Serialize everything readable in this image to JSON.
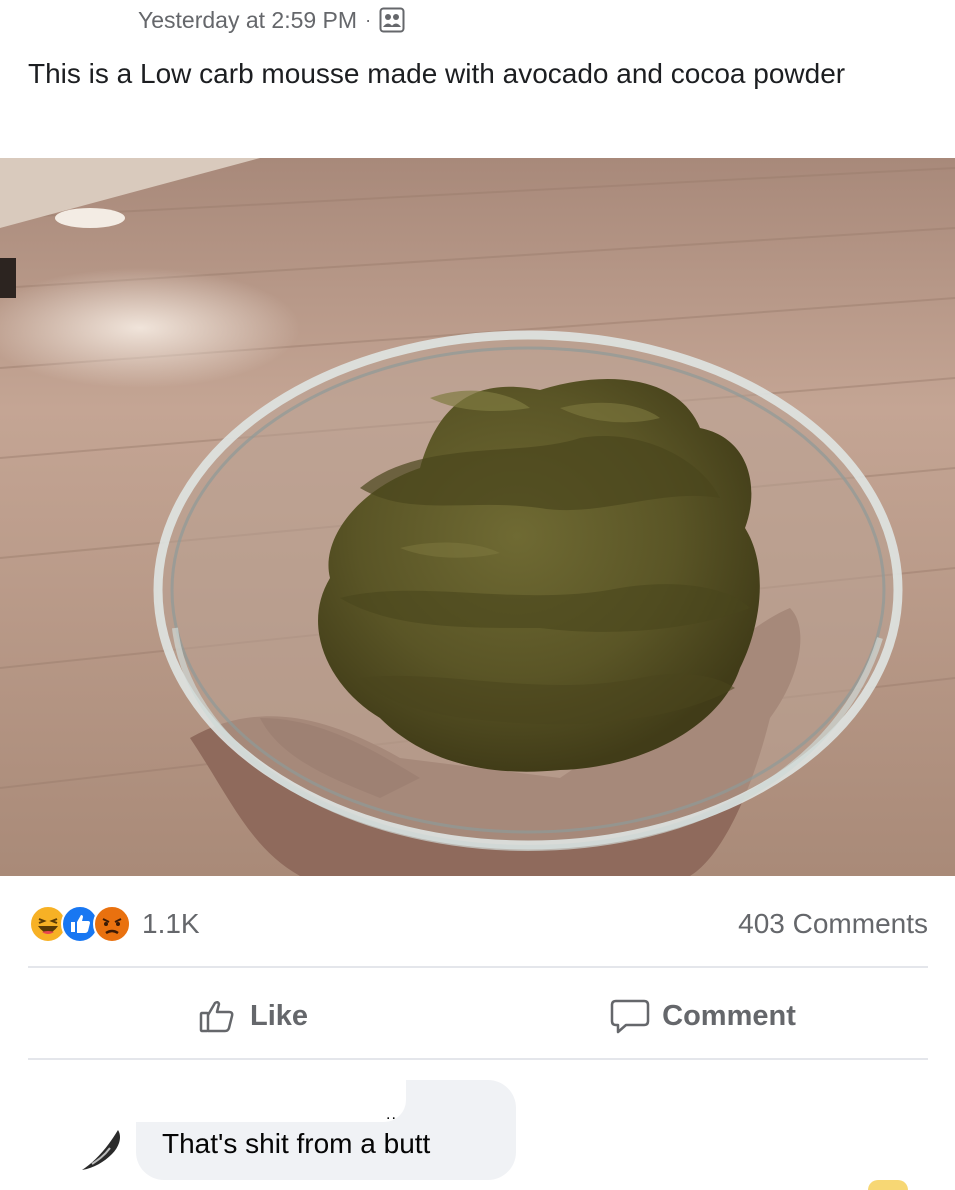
{
  "post": {
    "timestamp": "Yesterday at 2:59 PM",
    "separator": "·",
    "audience_icon": "friends-icon",
    "caption": "This is a Low carb mousse made with avocado and cocoa powder"
  },
  "photo": {
    "subject": "glass-bowl-of-brown-mousse"
  },
  "reactions": {
    "icons": [
      "haha-icon",
      "like-icon",
      "angry-icon"
    ],
    "count": "1.1K",
    "comments_label": "403 Comments"
  },
  "actions": {
    "like_label": "Like",
    "comment_label": "Comment"
  },
  "comment": {
    "author_tail": "..",
    "text": "That's shit from a butt"
  },
  "colors": {
    "secondary_text": "#65676b",
    "primary_text": "#1c1e21",
    "like_blue": "#1877f2",
    "haha_yellow": "#f7b125",
    "angry_orange": "#e9710f",
    "divider": "#e4e6eb",
    "bubble": "#f0f2f5"
  }
}
